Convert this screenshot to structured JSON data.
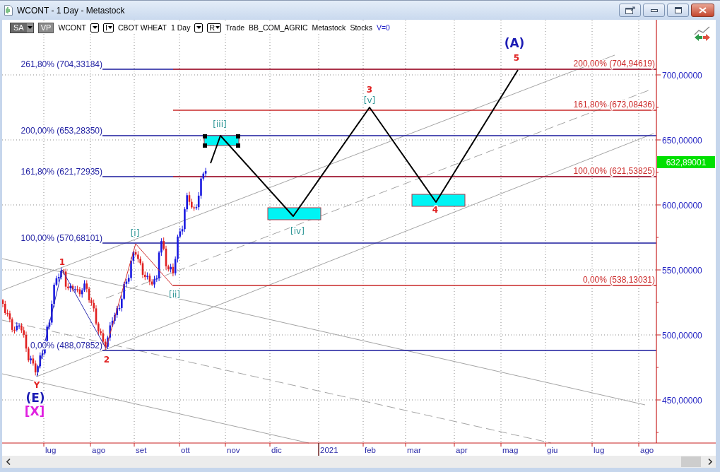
{
  "window": {
    "title": "WCONT - 1 Day - Metastock"
  },
  "toolbar": {
    "items": [
      {
        "kind": "dropdown",
        "label": "SA"
      },
      {
        "kind": "toggle",
        "label": "VP"
      },
      {
        "kind": "text",
        "label": "WCONT"
      },
      {
        "kind": "caret"
      },
      {
        "kind": "menu",
        "label": "I"
      },
      {
        "kind": "text",
        "label": "CBOT WHEAT"
      },
      {
        "kind": "text",
        "label": "1 Day"
      },
      {
        "kind": "caret"
      },
      {
        "kind": "menu",
        "label": "R"
      },
      {
        "kind": "text",
        "label": "Trade"
      },
      {
        "kind": "text",
        "label": "BB_COM_AGRIC"
      },
      {
        "kind": "text",
        "label": "Metastock"
      },
      {
        "kind": "text",
        "label": "Stocks"
      },
      {
        "kind": "value",
        "label": "V=0"
      }
    ]
  },
  "chart": {
    "wave_labels": [
      {
        "text": "(A)",
        "kind": "primary",
        "color": "#1c1cb4"
      },
      {
        "text": "5",
        "kind": "minor",
        "color": "#e02020"
      },
      {
        "text": "3",
        "kind": "minor",
        "color": "#e02020"
      },
      {
        "text": "[v]",
        "kind": "minute",
        "color": "#2a9494"
      },
      {
        "text": "[iii]",
        "kind": "minute",
        "color": "#2a9494"
      },
      {
        "text": "4",
        "kind": "minor",
        "color": "#e02020"
      },
      {
        "text": "[iv]",
        "kind": "minute",
        "color": "#2a9494"
      },
      {
        "text": "[i]",
        "kind": "minute",
        "color": "#2a9494"
      },
      {
        "text": "1",
        "kind": "minor",
        "color": "#e02020"
      },
      {
        "text": "[ii]",
        "kind": "minute",
        "color": "#2a9494"
      },
      {
        "text": "2",
        "kind": "minor",
        "color": "#e02020"
      },
      {
        "text": "Y",
        "kind": "minor",
        "color": "#e02020"
      },
      {
        "text": "(E)",
        "kind": "primary",
        "color": "#1c1cb4"
      },
      {
        "text": "[X]",
        "kind": "primary",
        "color": "#e020e0"
      }
    ],
    "fibonacci_levels_left": [
      "261,80% (704,33184)",
      "200,00% (653,28350)",
      "161,80% (621,72935)",
      "100,00% (570,68101)",
      "0,00% (488,07852)"
    ],
    "fibonacci_levels_right": [
      "200,00% (704,94619)",
      "161,80% (673,08436)",
      "100,00% (621,53825)",
      "0,00% (538,13031)"
    ],
    "price_axis": {
      "labels": [
        "700,00000",
        "650,00000",
        "600,00000",
        "550,00000",
        "500,00000",
        "450,00000"
      ],
      "last_price": "632,89001"
    },
    "time_axis": {
      "labels": [
        "lug",
        "ago",
        "set",
        "ott",
        "nov",
        "dic",
        "2021",
        "feb",
        "mar",
        "apr",
        "mag",
        "giu",
        "lug",
        "ago"
      ]
    }
  }
}
